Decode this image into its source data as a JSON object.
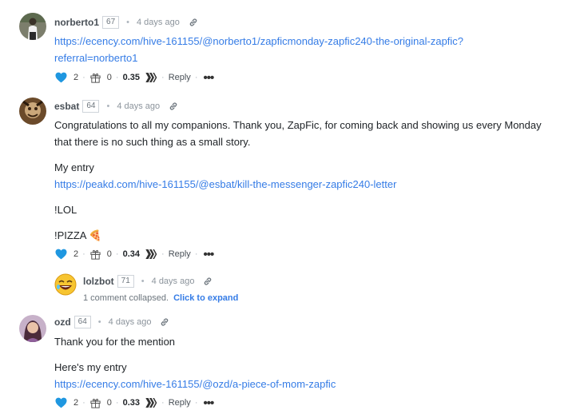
{
  "comments": [
    {
      "username": "norberto1",
      "reputation": "67",
      "time": "4 days ago",
      "link_line1": "https://ecency.com/hive-161155/@norberto1/zapficmonday-zapfic240-the-original-zapfic?",
      "link_line2": "referral=norberto1",
      "votes": "2",
      "gifts": "0",
      "payout": "0.35",
      "reply_label": "Reply",
      "more_label": "•••"
    },
    {
      "username": "esbat",
      "reputation": "64",
      "time": "4 days ago",
      "para1_line1": "Congratulations to all my companions. Thank you, ZapFic, for coming back and showing us every Monday",
      "para1_line2": "that there is no such thing as a small story.",
      "entry_label": "My entry",
      "entry_link": "https://peakd.com/hive-161155/@esbat/kill-the-messenger-zapfic240-letter",
      "lol": "!LOL",
      "pizza": "!PIZZA 🍕",
      "votes": "2",
      "gifts": "0",
      "payout": "0.34",
      "reply_label": "Reply",
      "more_label": "•••"
    },
    {
      "username": "lolzbot",
      "reputation": "71",
      "time": "4 days ago",
      "collapsed_text": "1 comment collapsed.",
      "expand_label": "Click to expand"
    },
    {
      "username": "ozd",
      "reputation": "64",
      "time": "4 days ago",
      "text1": "Thank you for the mention",
      "entry_label": "Here's my entry",
      "entry_link": "https://ecency.com/hive-161155/@ozd/a-piece-of-mom-zapfic",
      "votes": "2",
      "gifts": "0",
      "payout": "0.33",
      "reply_label": "Reply",
      "more_label": "•••"
    }
  ],
  "colors": {
    "link": "#357ce6",
    "heart": "#1f97e0"
  },
  "icons": [
    "heart-icon",
    "gift-icon",
    "hive-chevron-icon",
    "link-icon",
    "laughing-emoji-icon"
  ]
}
